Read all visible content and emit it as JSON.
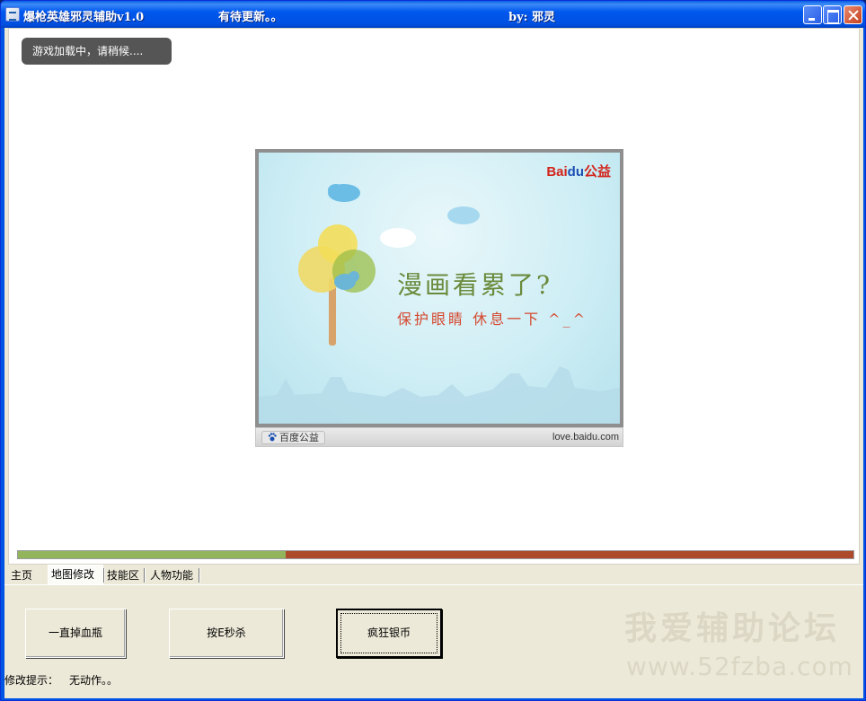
{
  "window": {
    "title": "爆枪英雄邪灵辅助v1.0",
    "update_note": "有待更新。。",
    "author": "by: 邪灵"
  },
  "browser": {
    "loading_toast": "游戏加载中，请稍候....",
    "ad": {
      "brand_bai": "Bai",
      "brand_du": "du",
      "brand_suffix": "公益",
      "headline": "漫画看累了?",
      "subline": "保护眼睛 休息一下 ^_^",
      "footer_left": "百度公益",
      "footer_right": "love.baidu.com"
    }
  },
  "progress": {
    "fraction": 0.32,
    "fill_color": "#92b55c",
    "track_color": "#ad4a2c"
  },
  "tabs": [
    {
      "label": "主页",
      "active": false
    },
    {
      "label": "地图修改",
      "active": true
    },
    {
      "label": "技能区",
      "active": false
    },
    {
      "label": "人物功能",
      "active": false
    }
  ],
  "buttons": {
    "drop_potion": "一直掉血瓶",
    "instant_kill": "按E秒杀",
    "crazy_coins": "疯狂银币"
  },
  "status": {
    "label": "修改提示：",
    "value": "无动作。。"
  },
  "watermark": {
    "name": "我爱辅助论坛",
    "url": "www.52fzba.com"
  }
}
